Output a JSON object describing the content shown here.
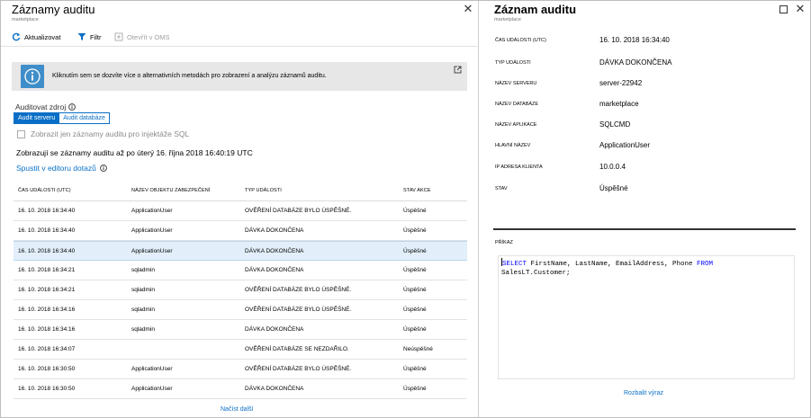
{
  "left": {
    "title": "Záznamy auditu",
    "subtitle": "marketplace",
    "toolbar": {
      "refresh": "Aktualizovat",
      "filter": "Filtr",
      "oms": "Otevřít v OMS"
    },
    "info_text": "Kliknutím sem se dozvíte více o alternativních metodách pro zobrazení a analýzu záznamů auditu.",
    "source_label": "Auditovat zdroj",
    "segment": {
      "server": "Audit serveru",
      "database": "Audit databáze"
    },
    "checkbox_label": "Zobrazit jen záznamy auditu pro injektáže SQL",
    "showing_text": "Zobrazují se záznamy auditu až po úterý 16. října 2018 16:40:19 UTC",
    "editor_link": "Spustit v editoru dotazů",
    "table": {
      "headers": [
        "ČAS UDÁLOSTI (UTC)",
        "NÁZEV OBJEKTU ZABEZPEČENÍ",
        "TYP UDÁLOSTI",
        "STAV AKCE"
      ],
      "rows": [
        [
          "16. 10. 2018 16:34:40",
          "ApplicationUser",
          "OVĚŘENÍ DATABÁZE BYLO ÚSPĚŠNÉ.",
          "Úspěšné"
        ],
        [
          "16. 10. 2018 16:34:40",
          "ApplicationUser",
          "DÁVKA DOKONČENA",
          "Úspěšné"
        ],
        [
          "16. 10. 2018 16:34:40",
          "ApplicationUser",
          "DÁVKA DOKONČENA",
          "Úspěšné"
        ],
        [
          "16. 10. 2018 16:34:21",
          "sqladmin",
          "DÁVKA DOKONČENA",
          "Úspěšné"
        ],
        [
          "16. 10. 2018 16:34:21",
          "sqladmin",
          "OVĚŘENÍ DATABÁZE BYLO ÚSPĚŠNÉ.",
          "Úspěšné"
        ],
        [
          "16. 10. 2018 16:34:16",
          "sqladmin",
          "OVĚŘENÍ DATABÁZE BYLO ÚSPĚŠNÉ.",
          "Úspěšné"
        ],
        [
          "16. 10. 2018 16:34:16",
          "sqladmin",
          "DÁVKA DOKONČENA",
          "Úspěšné"
        ],
        [
          "16. 10. 2018 16:34:07",
          "",
          "OVĚŘENÍ DATABÁZE SE NEZDAŘILO.",
          "Neúspěšné"
        ],
        [
          "16. 10. 2018 16:30:50",
          "ApplicationUser",
          "OVĚŘENÍ DATABÁZE BYLO ÚSPĚŠNÉ.",
          "Úspěšné"
        ],
        [
          "16. 10. 2018 16:30:50",
          "ApplicationUser",
          "DÁVKA DOKONČENA",
          "Úspěšné"
        ]
      ],
      "selected_row": 2
    },
    "load_more": "Načíst další"
  },
  "right": {
    "title": "Záznam auditu",
    "subtitle": "marketplace",
    "fields": [
      {
        "key": "ČAS UDÁLOSTI (UTC)",
        "value": "16. 10. 2018 16:34:40"
      },
      {
        "key": "TYP UDÁLOSTI",
        "value": "DÁVKA DOKONČENA"
      },
      {
        "key": "NÁZEV SERVERU",
        "value": "server-22942"
      },
      {
        "key": "NÁZEV DATABÁZE",
        "value": "marketplace"
      },
      {
        "key": "NÁZEV APLIKACE",
        "value": "SQLCMD"
      },
      {
        "key": "HLAVNÍ NÁZEV",
        "value": "ApplicationUser"
      },
      {
        "key": "IP ADRESA KLIENTA",
        "value": "10.0.0.4"
      },
      {
        "key": "STAV",
        "value": "Úspěšné"
      }
    ],
    "command_label": "PŘÍKAZ",
    "command": {
      "kw1": "SELECT",
      "mid": " FirstName, LastName, EmailAddress, Phone ",
      "kw2": "FROM",
      "line2": "SalesLT.Customer;"
    },
    "expand": "Rozbalit výraz"
  },
  "colors": {
    "accent": "#0a6fc6",
    "info_tile": "#3f8ec9",
    "selected_row": "#e2effa",
    "sql_keyword": "#0000ff"
  },
  "icons": [
    "refresh-icon",
    "filter-icon",
    "oms-icon",
    "info-icon",
    "external-link-icon",
    "close-icon",
    "maximize-icon"
  ]
}
